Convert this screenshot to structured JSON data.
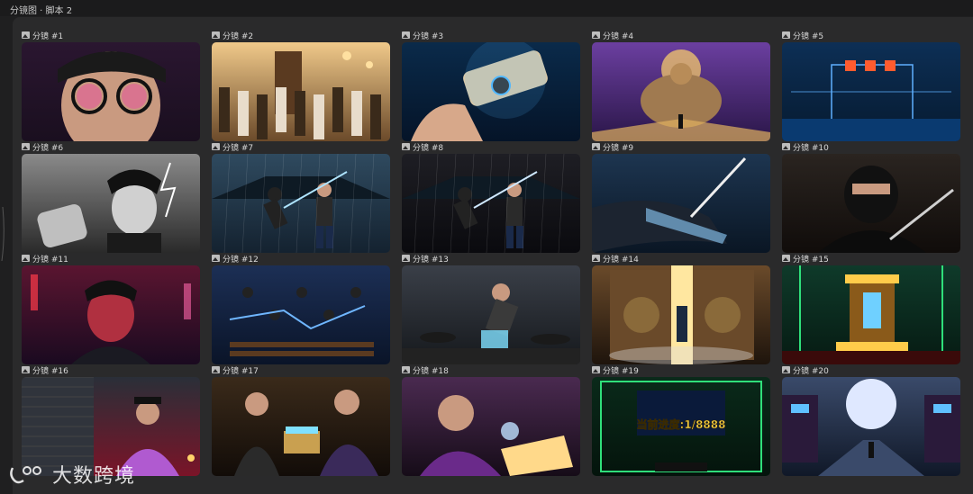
{
  "header": {
    "title": "分镜图 · 脚本 2"
  },
  "frames": [
    {
      "label": "分镜 #1",
      "bg1": "#2a1630",
      "bg2": "#1a0f1f",
      "accent": "#e5559a",
      "subject": "face-glasses"
    },
    {
      "label": "分镜 #2",
      "bg1": "#f0c98a",
      "bg2": "#6b4a2a",
      "accent": "#ffe0a0",
      "subject": "crowd-tower"
    },
    {
      "label": "分镜 #3",
      "bg1": "#0a2a4a",
      "bg2": "#051428",
      "accent": "#4fb8ff",
      "subject": "scroll-hand"
    },
    {
      "label": "分镜 #4",
      "bg1": "#6b3fa0",
      "bg2": "#2a1648",
      "accent": "#ffd36a",
      "subject": "buddha"
    },
    {
      "label": "分镜 #5",
      "bg1": "#0d2f55",
      "bg2": "#061a30",
      "accent": "#ff5b2e",
      "subject": "gate-hud"
    },
    {
      "label": "分镜 #6",
      "bg1": "#8a8a8a",
      "bg2": "#2a2a2a",
      "accent": "#ffffff",
      "subject": "boy-lightning"
    },
    {
      "label": "分镜 #7",
      "bg1": "#2f4a5f",
      "bg2": "#142230",
      "accent": "#aee4ff",
      "subject": "fight-courtyard"
    },
    {
      "label": "分镜 #8",
      "bg1": "#1e1e24",
      "bg2": "#0a0a0e",
      "accent": "#cfe8ff",
      "subject": "fight-rain"
    },
    {
      "label": "分镜 #9",
      "bg1": "#1d3550",
      "bg2": "#0a1624",
      "accent": "#8fd0ff",
      "subject": "arm-blade"
    },
    {
      "label": "分镜 #10",
      "bg1": "#2a2420",
      "bg2": "#100c0a",
      "accent": "#d0d0d0",
      "subject": "ninja-knife"
    },
    {
      "label": "分镜 #11",
      "bg1": "#5a1530",
      "bg2": "#1a0a20",
      "accent": "#ff3a4a",
      "subject": "boy-red-glow"
    },
    {
      "label": "分镜 #12",
      "bg1": "#1c2f55",
      "bg2": "#0a1428",
      "accent": "#6fb6ff",
      "subject": "battle-lightning"
    },
    {
      "label": "分镜 #13",
      "bg1": "#3a3f48",
      "bg2": "#15181c",
      "accent": "#7fe0ff",
      "subject": "boy-chest"
    },
    {
      "label": "分镜 #14",
      "bg1": "#6a4a2a",
      "bg2": "#1e140c",
      "accent": "#ffe7a0",
      "subject": "door-light"
    },
    {
      "label": "分镜 #15",
      "bg1": "#0f3a2a",
      "bg2": "#061a12",
      "accent": "#ffcc4a",
      "subject": "throne-green"
    },
    {
      "label": "分镜 #16",
      "bg1": "#2a2f38",
      "bg2": "#7a1428",
      "accent": "#b05ad0",
      "subject": "man-server"
    },
    {
      "label": "分镜 #17",
      "bg1": "#3a2a1a",
      "bg2": "#120c08",
      "accent": "#7fe0ff",
      "subject": "boy-box"
    },
    {
      "label": "分镜 #18",
      "bg1": "#4a2a50",
      "bg2": "#160c18",
      "accent": "#ffd98a",
      "subject": "man-book"
    },
    {
      "label": "分镜 #19",
      "bg1": "#0a2a1a",
      "bg2": "#04140c",
      "accent": "#ffd84a",
      "subject": "progress-screen",
      "overlay_text": "当前进度:1/8888"
    },
    {
      "label": "分镜 #20",
      "bg1": "#3a4a6a",
      "bg2": "#101828",
      "accent": "#dfe8ff",
      "subject": "moon-street"
    }
  ],
  "watermark": {
    "text": "大数跨境"
  }
}
